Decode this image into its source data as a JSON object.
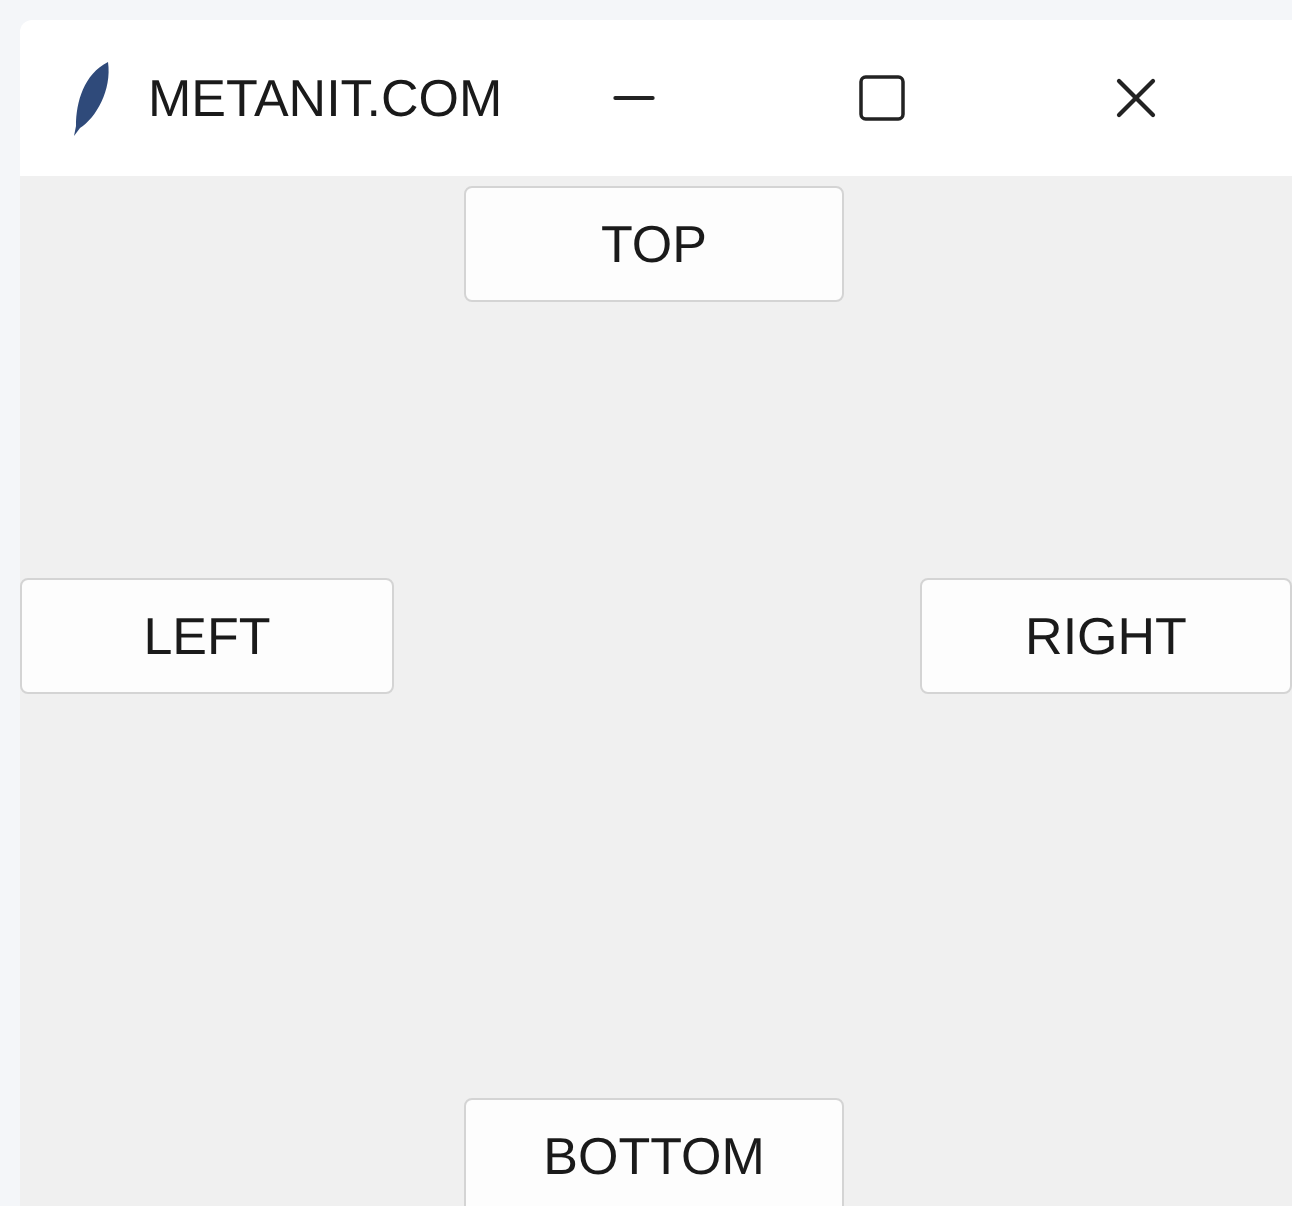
{
  "window": {
    "title": "METANIT.COM"
  },
  "buttons": [
    {
      "label": "TOP",
      "kind": "top"
    },
    {
      "label": "LEFT",
      "kind": "left"
    },
    {
      "label": "RIGHT",
      "kind": "right"
    },
    {
      "label": "BOTTOM",
      "kind": "bottom"
    }
  ]
}
